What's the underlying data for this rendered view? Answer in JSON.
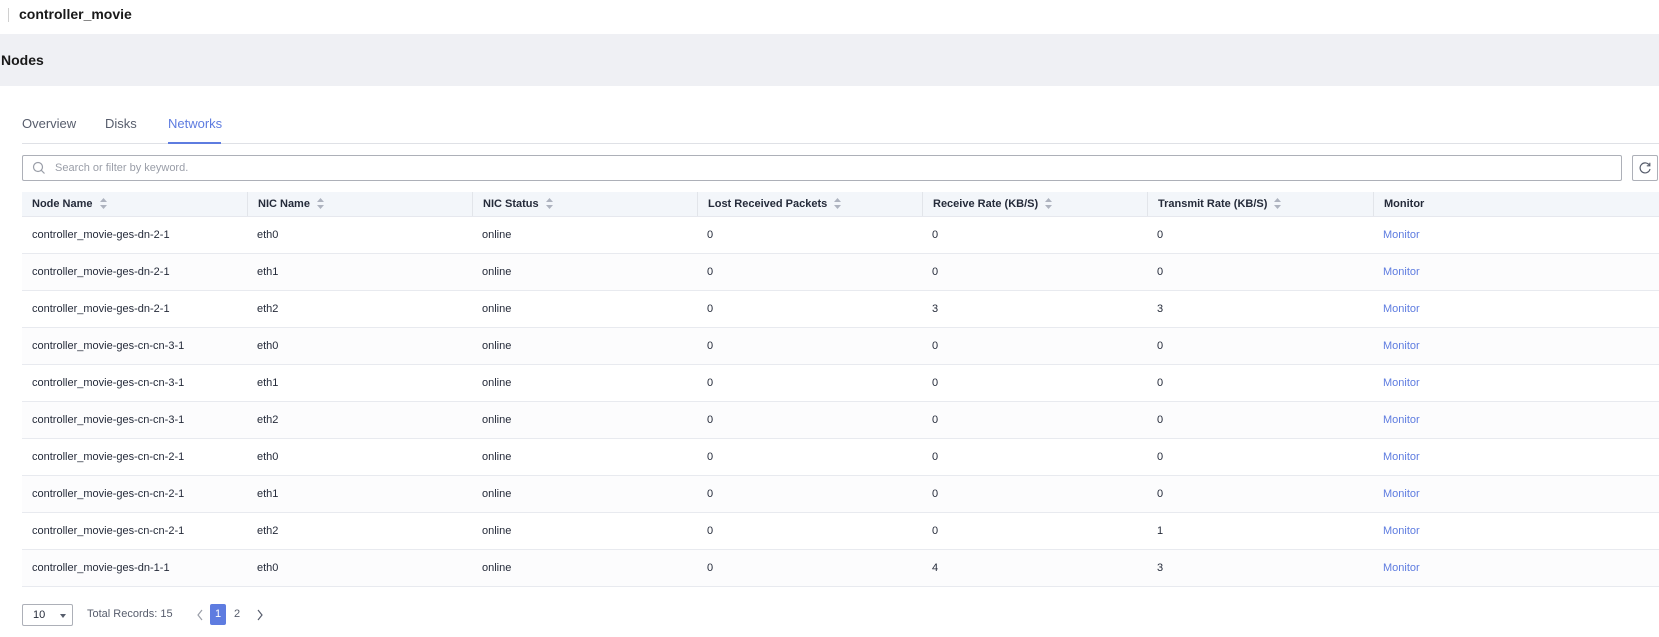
{
  "app": {
    "title": "controller_movie"
  },
  "section": {
    "title": "Nodes"
  },
  "tabs": [
    {
      "label": "Overview",
      "active": false
    },
    {
      "label": "Disks",
      "active": false
    },
    {
      "label": "Networks",
      "active": true
    }
  ],
  "search": {
    "placeholder": "Search or filter by keyword.",
    "value": ""
  },
  "table": {
    "columns": [
      "Node Name",
      "NIC Name",
      "NIC Status",
      "Lost Received Packets",
      "Receive Rate (KB/S)",
      "Transmit Rate (KB/S)",
      "Monitor"
    ],
    "rows": [
      {
        "node": "controller_movie-ges-dn-2-1",
        "nic": "eth0",
        "status": "online",
        "lost": "0",
        "rx": "0",
        "tx": "0",
        "monitor": "Monitor"
      },
      {
        "node": "controller_movie-ges-dn-2-1",
        "nic": "eth1",
        "status": "online",
        "lost": "0",
        "rx": "0",
        "tx": "0",
        "monitor": "Monitor"
      },
      {
        "node": "controller_movie-ges-dn-2-1",
        "nic": "eth2",
        "status": "online",
        "lost": "0",
        "rx": "3",
        "tx": "3",
        "monitor": "Monitor"
      },
      {
        "node": "controller_movie-ges-cn-cn-3-1",
        "nic": "eth0",
        "status": "online",
        "lost": "0",
        "rx": "0",
        "tx": "0",
        "monitor": "Monitor"
      },
      {
        "node": "controller_movie-ges-cn-cn-3-1",
        "nic": "eth1",
        "status": "online",
        "lost": "0",
        "rx": "0",
        "tx": "0",
        "monitor": "Monitor"
      },
      {
        "node": "controller_movie-ges-cn-cn-3-1",
        "nic": "eth2",
        "status": "online",
        "lost": "0",
        "rx": "0",
        "tx": "0",
        "monitor": "Monitor"
      },
      {
        "node": "controller_movie-ges-cn-cn-2-1",
        "nic": "eth0",
        "status": "online",
        "lost": "0",
        "rx": "0",
        "tx": "0",
        "monitor": "Monitor"
      },
      {
        "node": "controller_movie-ges-cn-cn-2-1",
        "nic": "eth1",
        "status": "online",
        "lost": "0",
        "rx": "0",
        "tx": "0",
        "monitor": "Monitor"
      },
      {
        "node": "controller_movie-ges-cn-cn-2-1",
        "nic": "eth2",
        "status": "online",
        "lost": "0",
        "rx": "0",
        "tx": "1",
        "monitor": "Monitor"
      },
      {
        "node": "controller_movie-ges-dn-1-1",
        "nic": "eth0",
        "status": "online",
        "lost": "0",
        "rx": "4",
        "tx": "3",
        "monitor": "Monitor"
      }
    ]
  },
  "pagination": {
    "page_size": "10",
    "total_label": "Total Records: 15",
    "pages": [
      "1",
      "2"
    ],
    "current_page": "1"
  },
  "colors": {
    "accent": "#5e7ce0",
    "section_bg": "#eff0f4",
    "header_bg": "#f3f6fa"
  },
  "icons": {
    "search": "search-icon",
    "refresh": "refresh-icon",
    "sort": "sort-icon",
    "prev": "chevron-left-icon",
    "next": "chevron-right-icon",
    "dropdown": "caret-down-icon"
  }
}
